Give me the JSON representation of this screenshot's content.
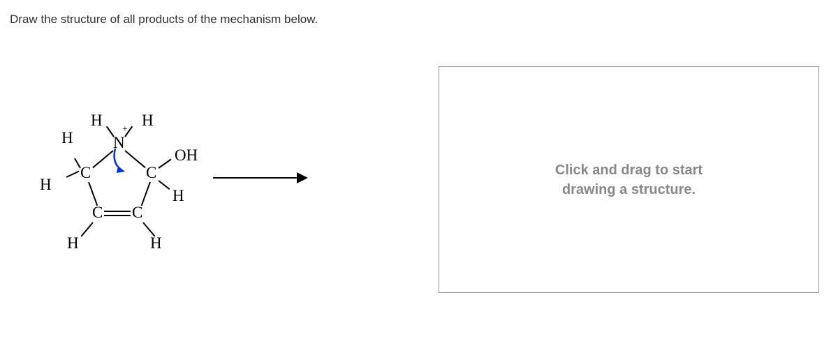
{
  "prompt": "Draw the structure of all products of the mechanism below.",
  "structure": {
    "atoms": {
      "N": "N",
      "H_top_left": "H",
      "H_top_right": "H",
      "H_left_upper": "H",
      "H_left": "H",
      "C_left": "C",
      "C_right": "C",
      "C_bottom_left": "C",
      "C_bottom_right": "C",
      "H_right": "H",
      "OH": "OH",
      "H_bottom_left": "H",
      "H_bottom_right": "H"
    },
    "plus": "+"
  },
  "drawbox": {
    "placeholder_line1": "Click and drag to start",
    "placeholder_line2": "drawing a structure."
  }
}
